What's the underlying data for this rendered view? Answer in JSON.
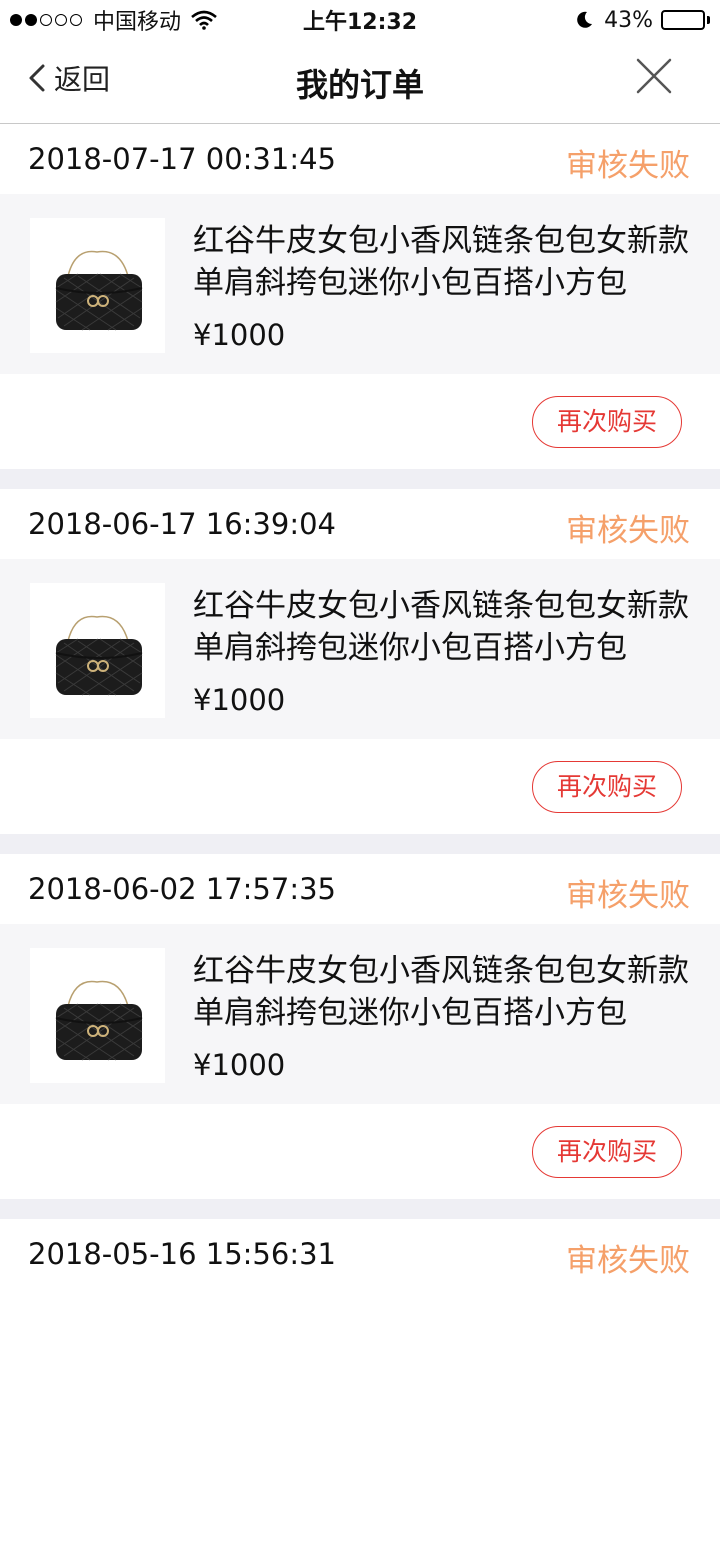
{
  "status_bar": {
    "carrier": "中国移动",
    "time": "上午12:32",
    "battery": "43%",
    "battery_level": 0.43
  },
  "nav": {
    "back_label": "返回",
    "title": "我的订单"
  },
  "orders": [
    {
      "date": "2018-07-17 00:31:45",
      "status": "审核失败",
      "title": "红谷牛皮女包小香风链条包包女新款单肩斜挎包迷你小包百搭小方包",
      "price": "¥1000",
      "button": "再次购买"
    },
    {
      "date": "2018-06-17 16:39:04",
      "status": "审核失败",
      "title": "红谷牛皮女包小香风链条包包女新款单肩斜挎包迷你小包百搭小方包",
      "price": "¥1000",
      "button": "再次购买"
    },
    {
      "date": "2018-06-02 17:57:35",
      "status": "审核失败",
      "title": "红谷牛皮女包小香风链条包包女新款单肩斜挎包迷你小包百搭小方包",
      "price": "¥1000",
      "button": "再次购买"
    },
    {
      "date": "2018-05-16 15:56:31",
      "status": "审核失败"
    }
  ],
  "colors": {
    "status_text": "#f5a06a",
    "rebuy_button": "#e53935",
    "item_background": "#f6f6f8",
    "separator": "#efeff4"
  }
}
